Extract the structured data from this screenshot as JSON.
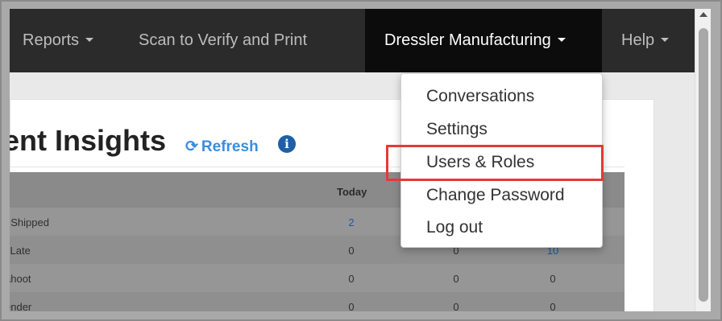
{
  "navbar": {
    "reports": "Reports",
    "scan": "Scan to Verify and Print",
    "company": "Dressler Manufacturing",
    "help": "Help"
  },
  "dropdown": {
    "items": [
      "Conversations",
      "Settings",
      "Users & Roles",
      "Change Password",
      "Log out"
    ],
    "highlighted_item": "Users & Roles",
    "highlight_color": "#e53935"
  },
  "insights": {
    "title": "ent Insights",
    "refresh_label": "Refresh",
    "refresh_icon": "refresh-icon",
    "info_icon": "info-icon",
    "info_glyph": "i"
  },
  "table": {
    "headers": [
      "Today"
    ],
    "rows": [
      {
        "label": "t Shipped",
        "today": "2"
      },
      {
        "label": "i Late",
        "today": "0",
        "col2": "0",
        "col3": "10"
      },
      {
        "label": "ahoot",
        "today": "0",
        "col2": "0",
        "col3": "0"
      },
      {
        "label": "ender",
        "today": "0",
        "col2": "0",
        "col3": "0"
      }
    ]
  },
  "colors": {
    "navbar_bg": "#2b2b2b",
    "active_nav_bg": "#0c0c0c",
    "link": "#3a8dde"
  }
}
